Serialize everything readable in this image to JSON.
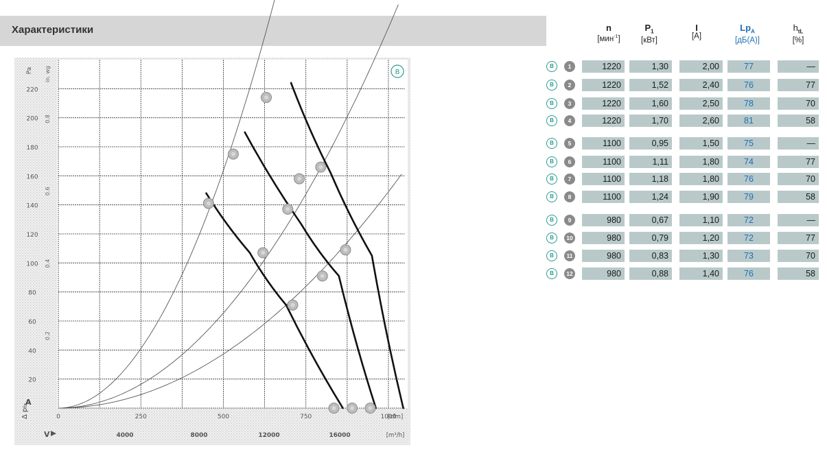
{
  "page": {
    "title": "Характеристики"
  },
  "table": {
    "headers": [
      {
        "symbol": "n",
        "unit": "[мин-1]",
        "color": "#222222"
      },
      {
        "symbol": "P1",
        "unit": "[кВт]",
        "color": "#222222"
      },
      {
        "symbol": "I",
        "unit": "[A]",
        "color": "#222222"
      },
      {
        "symbol": "LpA",
        "unit": "[дБ(A)]",
        "color": "#1c6fb8"
      },
      {
        "symbol": "htL",
        "unit": "[%]",
        "color": "#222222"
      }
    ],
    "badge_letter": "B",
    "rows": [
      {
        "no": "1",
        "n": "1220",
        "p1": "1,30",
        "i": "2,00",
        "lp": "77",
        "h": "—"
      },
      {
        "no": "2",
        "n": "1220",
        "p1": "1,52",
        "i": "2,40",
        "lp": "76",
        "h": "77"
      },
      {
        "no": "3",
        "n": "1220",
        "p1": "1,60",
        "i": "2,50",
        "lp": "78",
        "h": "70"
      },
      {
        "no": "4",
        "n": "1220",
        "p1": "1,70",
        "i": "2,60",
        "lp": "81",
        "h": "58"
      },
      {
        "no": "5",
        "n": "1100",
        "p1": "0,95",
        "i": "1,50",
        "lp": "75",
        "h": "—"
      },
      {
        "no": "6",
        "n": "1100",
        "p1": "1,11",
        "i": "1,80",
        "lp": "74",
        "h": "77"
      },
      {
        "no": "7",
        "n": "1100",
        "p1": "1,18",
        "i": "1,80",
        "lp": "76",
        "h": "70"
      },
      {
        "no": "8",
        "n": "1100",
        "p1": "1,24",
        "i": "1,90",
        "lp": "79",
        "h": "58"
      },
      {
        "no": "9",
        "n": "980",
        "p1": "0,67",
        "i": "1,10",
        "lp": "72",
        "h": "—"
      },
      {
        "no": "10",
        "n": "980",
        "p1": "0,79",
        "i": "1,20",
        "lp": "72",
        "h": "77"
      },
      {
        "no": "11",
        "n": "980",
        "p1": "0,83",
        "i": "1,30",
        "lp": "73",
        "h": "70"
      },
      {
        "no": "12",
        "n": "980",
        "p1": "0,88",
        "i": "1,40",
        "lp": "76",
        "h": "58"
      }
    ]
  },
  "chart_data": {
    "type": "line",
    "corner_badge": "B",
    "x_ticks": [
      "0",
      "250",
      "500",
      "750",
      "1000"
    ],
    "x_unit": "[cfm]",
    "x2_ticks": [
      "4000",
      "8000",
      "12000",
      "16000"
    ],
    "x2_unit": "[m³/h]",
    "y_ticks": [
      "20",
      "40",
      "60",
      "80",
      "100",
      "120",
      "140",
      "160",
      "180",
      "200",
      "220"
    ],
    "y2_ticks": [
      "0.2",
      "0.4",
      "0.6",
      "0.8"
    ],
    "y_unit": "Pa",
    "y2_unit": "in. wg",
    "xlim": [
      0,
      1050
    ],
    "ylim": [
      0,
      240
    ],
    "grid": true,
    "series": [
      {
        "name": "1220",
        "points": [
          [
            705,
            224
          ],
          [
            825,
            162
          ],
          [
            950,
            105
          ],
          [
            1045,
            0
          ]
        ]
      },
      {
        "name": "1100",
        "points": [
          [
            565,
            190
          ],
          [
            735,
            127
          ],
          [
            850,
            91
          ],
          [
            962,
            0
          ]
        ]
      },
      {
        "name": "980",
        "points": [
          [
            448,
            148
          ],
          [
            580,
            107
          ],
          [
            690,
            71
          ],
          [
            862,
            0
          ]
        ]
      }
    ],
    "system_curves": [
      {
        "k": 0.000655,
        "x_end": 717
      },
      {
        "k": 0.000262,
        "x_end": 1030
      },
      {
        "k": 0.000149,
        "x_end": 1045
      }
    ],
    "markers": [
      [
        630,
        214
      ],
      [
        795,
        166
      ],
      [
        455,
        141
      ],
      [
        730,
        158
      ],
      [
        530,
        175
      ],
      [
        695,
        137
      ],
      [
        870,
        109
      ],
      [
        800,
        91
      ],
      [
        620,
        107
      ],
      [
        710,
        71
      ],
      [
        890,
        0
      ],
      [
        835,
        0
      ],
      [
        945,
        0
      ]
    ]
  }
}
